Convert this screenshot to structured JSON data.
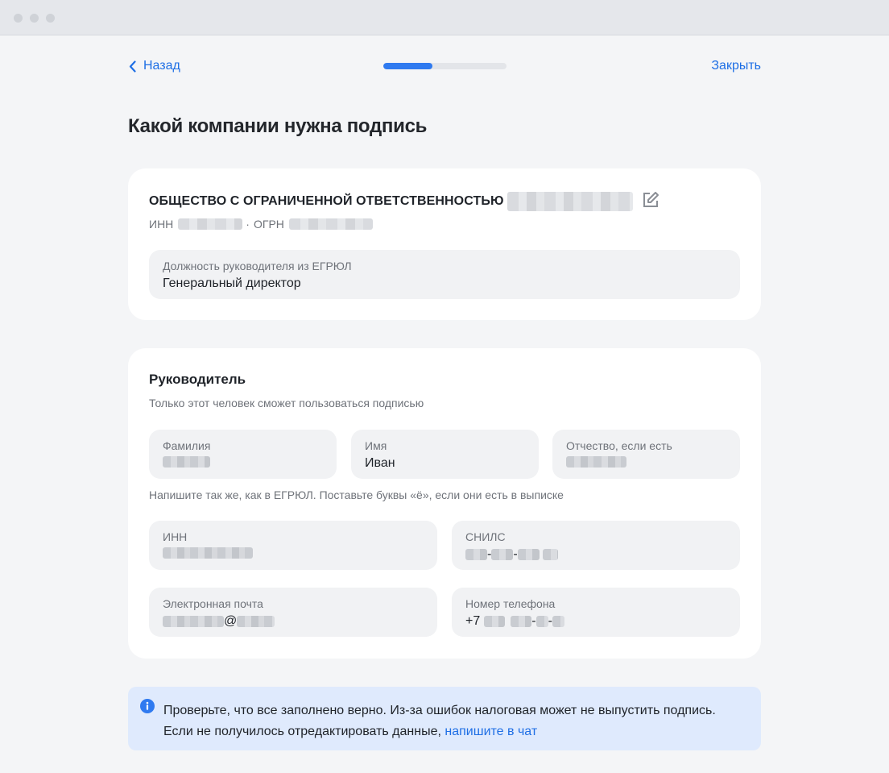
{
  "header": {
    "back_label": "Назад",
    "close_label": "Закрыть",
    "progress_fraction": 0.4
  },
  "page_title": "Какой компании нужна подпись",
  "company": {
    "name": "ОБЩЕСТВО С ОГРАНИЧЕННОЙ ОТВЕТСТВЕННОСТЬЮ",
    "inn_label": "ИНН",
    "separator": "·",
    "ogrn_label": "ОГРН",
    "position_field": {
      "label": "Должность руководителя из ЕГРЮЛ",
      "value": "Генеральный директор"
    }
  },
  "director": {
    "title": "Руководитель",
    "subtitle": "Только этот человек сможет пользоваться подписью",
    "surname_label": "Фамилия",
    "name_label": "Имя",
    "name_value": "Иван",
    "patronymic_label": "Отчество, если есть",
    "hint": "Напишите так же, как в ЕГРЮЛ. Поставьте буквы «ё», если они есть в выписке",
    "inn_label": "ИНН",
    "snils_label": "СНИЛС",
    "snils_sep": "-",
    "email_label": "Электронная почта",
    "email_at": "@",
    "phone_label": "Номер телефона",
    "phone_prefix": "+7"
  },
  "notice": {
    "text_line1": "Проверьте, что все заполнено верно. Из-за ошибок налоговая может не выпустить подпись.",
    "text_line2": "Если не получилось отредактировать данные,",
    "link": "напишите в чат"
  },
  "colors": {
    "accent": "#1f6fe5",
    "progress": "#2f7af0",
    "notice_bg": "#dfeafd"
  }
}
